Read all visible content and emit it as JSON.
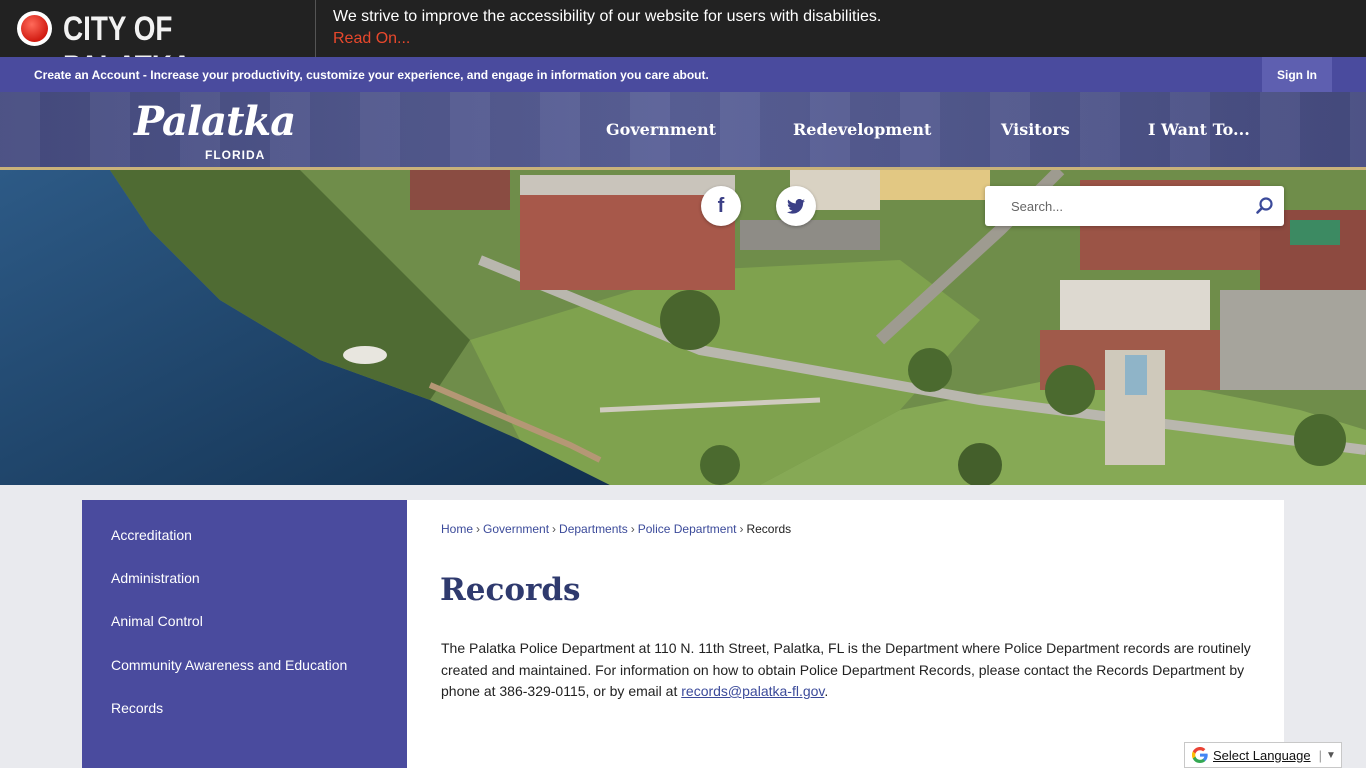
{
  "access_bar": {
    "site_title": "CITY OF PALATKA",
    "message": "We strive to improve the accessibility of our website for users with disabilities.",
    "read_on": "Read On..."
  },
  "account_bar": {
    "text": "Create an Account - Increase your productivity, customize your experience, and engage in information you care about.",
    "sign_in": "Sign In"
  },
  "header": {
    "logo_script": "Palatka",
    "logo_sub": "FLORIDA",
    "nav": [
      "Government",
      "Redevelopment",
      "Visitors",
      "I Want To..."
    ]
  },
  "hero": {
    "social": [
      "f",
      "twitter-icon"
    ],
    "search_placeholder": "Search..."
  },
  "sidebar": {
    "items": [
      "Accreditation",
      "Administration",
      "Animal Control",
      "Community Awareness and Education",
      "Records"
    ]
  },
  "breadcrumb": [
    "Home",
    "Government",
    "Departments",
    "Police Department",
    "Records"
  ],
  "page": {
    "title": "Records",
    "body_before_link": "The Palatka Police Department at 110 N. 11th Street, Palatka, FL is the Department where Police Department records are routinely created and maintained.  For information on how to obtain Police Department Records, please contact the Records Department by phone at 386-329-0115, or by email at ",
    "email": "records@palatka-fl.gov",
    "body_after_link": "."
  },
  "translate": {
    "label": "Select Language",
    "arrow": "▼"
  },
  "colors": {
    "brand_blue": "#4a4b9e",
    "title_navy": "#2f3a6e",
    "read_on_red": "#e8482c"
  }
}
